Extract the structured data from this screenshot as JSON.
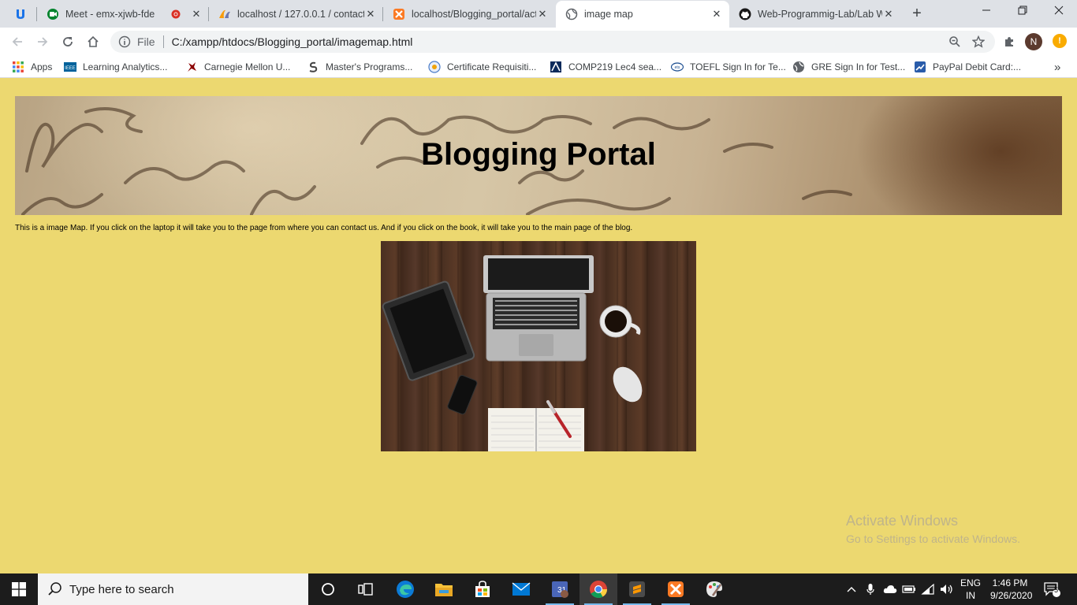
{
  "browser": {
    "tabs": [
      {
        "title": "",
        "icon": "extension-u-icon"
      },
      {
        "title": "Meet - emx-xjwb-fde",
        "icon": "google-meet-icon",
        "recording": true
      },
      {
        "title": "localhost / 127.0.0.1 / contact",
        "icon": "phpmyadmin-icon"
      },
      {
        "title": "localhost/Blogging_portal/act",
        "icon": "xampp-icon"
      },
      {
        "title": "image map",
        "icon": "globe-icon",
        "active": true
      },
      {
        "title": "Web-Programmig-Lab/Lab W",
        "icon": "github-icon"
      }
    ],
    "address": {
      "scheme_label": "File",
      "url": "C:/xampp/htdocs/Blogging_portal/imagemap.html"
    },
    "profile_initial": "N",
    "update_badge": "!",
    "bookmarks": [
      {
        "label": "Apps",
        "icon": "apps-grid-icon"
      },
      {
        "label": "Learning Analytics...",
        "icon": "ieee-icon"
      },
      {
        "label": "Carnegie Mellon U...",
        "icon": "cmu-icon"
      },
      {
        "label": "Master's Programs...",
        "icon": "masters-icon"
      },
      {
        "label": "Certificate Requisiti...",
        "icon": "certificate-icon"
      },
      {
        "label": "COMP219 Lec4 sea...",
        "icon": "comp219-icon"
      },
      {
        "label": "TOEFL Sign In for Te...",
        "icon": "ets-icon"
      },
      {
        "label": "GRE Sign In for Test...",
        "icon": "gre-globe-icon"
      },
      {
        "label": "PayPal Debit Card:...",
        "icon": "paypal-chart-icon"
      }
    ],
    "bookmarks_overflow": "»"
  },
  "page": {
    "heading": "Blogging Portal",
    "description": "This is a image Map. If you click on the laptop it will take you to the page from where you can contact us. And if you click on the book, it will take you to the main page of the blog.",
    "image_alt": "Desk with laptop, tablet, phone, coffee cup, mouse and notebook",
    "areas": [
      {
        "name": "laptop",
        "target": "contact page"
      },
      {
        "name": "book",
        "target": "main page of the blog"
      }
    ]
  },
  "watermark": {
    "line1": "Activate Windows",
    "line2": "Go to Settings to activate Windows."
  },
  "taskbar": {
    "search_placeholder": "Type here to search",
    "pinned": [
      "cortana-icon",
      "task-view-icon",
      "edge-icon",
      "file-explorer-icon",
      "store-icon",
      "mail-icon",
      "calendar-icon",
      "chrome-icon",
      "sublime-icon",
      "xampp-icon",
      "paint-icon"
    ],
    "language_top": "ENG",
    "language_bottom": "IN",
    "time": "1:46 PM",
    "date": "9/26/2020",
    "notifications": "5"
  },
  "colors": {
    "page_background": "#ecd870",
    "tab_strip": "#dee1e6",
    "taskbar": "#1c1c1c"
  }
}
